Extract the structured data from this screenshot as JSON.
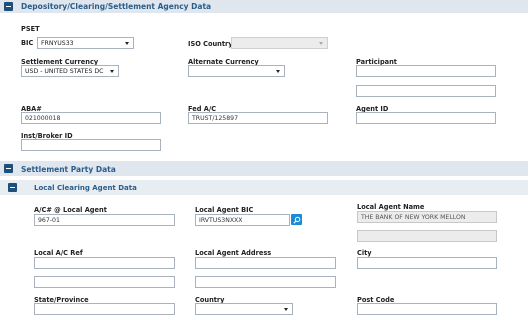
{
  "depository": {
    "title": "Depository/Clearing/Settlement Agency Data",
    "pset_label": "PSET",
    "bic_label": "BIC",
    "bic_value": "FRNYUS33",
    "iso_country_label": "ISO Country",
    "iso_country_value": "",
    "settlement_currency_label": "Settlement Currency",
    "settlement_currency_value": "USD - UNITED STATES DC",
    "alternate_currency_label": "Alternate Currency",
    "alternate_currency_value": "",
    "participant_label": "Participant",
    "participant_value": "",
    "participant_value_2": "",
    "aba_label": "ABA#",
    "aba_value": "021000018",
    "fed_ac_label": "Fed A/C",
    "fed_ac_value": "TRUST/125897",
    "agent_id_label": "Agent ID",
    "agent_id_value": "",
    "inst_broker_label": "Inst/Broker ID",
    "inst_broker_value": ""
  },
  "settlement_party": {
    "title": "Settlement Party Data",
    "local_clearing": {
      "title": "Local Clearing Agent Data",
      "ac_label": "A/C# @ Local Agent",
      "ac_value": "967-01",
      "bic_label": "Local Agent BIC",
      "bic_value": "IRVTUS3NXXX",
      "name_label": "Local Agent Name",
      "name_value": "THE BANK OF NEW YORK MELLON",
      "name_value_2": "",
      "ref_label": "Local A/C Ref",
      "ref_value": "",
      "ref_value_2": "",
      "address_label": "Local Agent Address",
      "address_value": "",
      "address_value_2": "",
      "city_label": "City",
      "city_value": "",
      "state_label": "State/Province",
      "state_value": "",
      "country_label": "Country",
      "country_value": "",
      "postcode_label": "Post Code",
      "postcode_value": ""
    }
  }
}
